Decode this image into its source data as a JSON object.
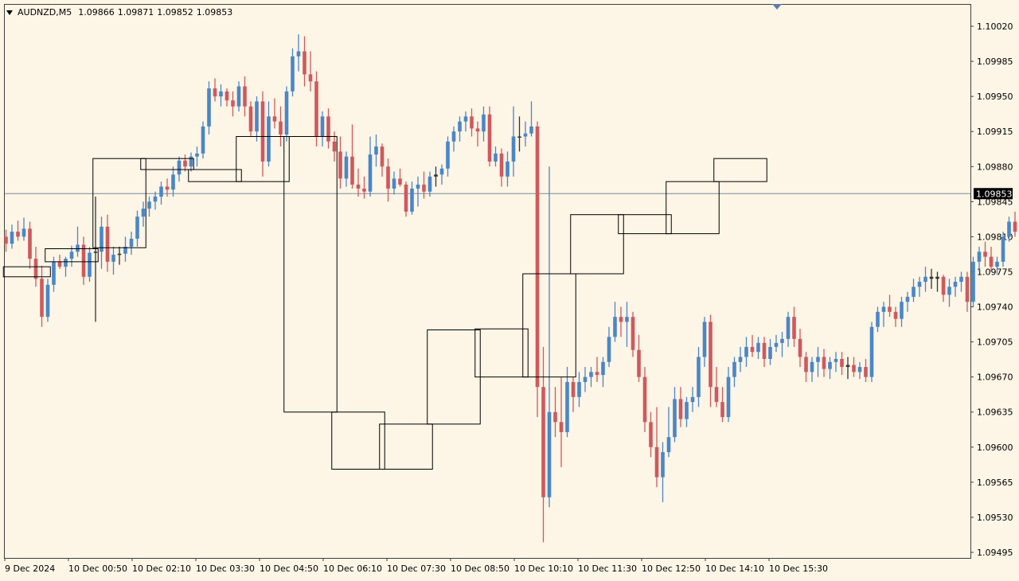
{
  "header": {
    "symbol": "AUDNZD,M5",
    "open": "1.09866",
    "high": "1.09871",
    "low": "1.09852",
    "close": "1.09853"
  },
  "colors": {
    "background": "#fdf5e6",
    "bull": "#4a86c8",
    "bear": "#d0585c",
    "doji": "#333333",
    "highlight": "#5ad45a",
    "box": "#000000",
    "price_line": "#7b8c9c",
    "price_tag_bg": "#000000"
  },
  "chart_data": {
    "type": "candlestick",
    "timeframe": "M5",
    "ylim": [
      1.09495,
      1.1004
    ],
    "y_ticks": [
      "1.10020",
      "1.09985",
      "1.09950",
      "1.09915",
      "1.09880",
      "1.09845",
      "1.09810",
      "1.09775",
      "1.09740",
      "1.09705",
      "1.09670",
      "1.09635",
      "1.09600",
      "1.09565",
      "1.09530",
      "1.09495"
    ],
    "x_ticks": [
      "9 Dec 2024",
      "10 Dec 00:50",
      "10 Dec 02:10",
      "10 Dec 03:30",
      "10 Dec 04:50",
      "10 Dec 06:10",
      "10 Dec 07:30",
      "10 Dec 08:50",
      "10 Dec 10:10",
      "10 Dec 11:30",
      "10 Dec 12:50",
      "10 Dec 14:10",
      "10 Dec 15:30"
    ],
    "current_price": "1.09853",
    "candles": [
      [
        1.0981,
        1.09817,
        1.09795,
        1.09803
      ],
      [
        1.09803,
        1.09822,
        1.09798,
        1.09815
      ],
      [
        1.09815,
        1.09826,
        1.09806,
        1.0981
      ],
      [
        1.0981,
        1.09829,
        1.09806,
        1.09818
      ],
      [
        1.09818,
        1.09825,
        1.09778,
        1.09788
      ],
      [
        1.09788,
        1.098,
        1.0976,
        1.09768
      ],
      [
        1.09768,
        1.09781,
        1.0972,
        1.0973
      ],
      [
        1.0973,
        1.09768,
        1.09725,
        1.09762
      ],
      [
        1.09762,
        1.0979,
        1.09755,
        1.09785
      ],
      [
        1.09785,
        1.09792,
        1.09778,
        1.0978
      ],
      [
        1.0978,
        1.0979,
        1.0977,
        1.09788
      ],
      [
        1.09788,
        1.09801,
        1.0978,
        1.09795
      ],
      [
        1.09795,
        1.0982,
        1.0979,
        1.09802
      ],
      [
        1.09802,
        1.0981,
        1.09762,
        1.0977
      ],
      [
        1.0977,
        1.098,
        1.09765,
        1.09794
      ],
      [
        1.09794,
        1.0985,
        1.09725,
        1.09795
      ],
      [
        1.09795,
        1.0983,
        1.09778,
        1.0982
      ],
      [
        1.0982,
        1.09832,
        1.09775,
        1.09785
      ],
      [
        1.09785,
        1.098,
        1.09772,
        1.09792
      ],
      [
        1.09792,
        1.098,
        1.09782,
        1.09793
      ],
      [
        1.09793,
        1.0981,
        1.09785,
        1.098
      ],
      [
        1.098,
        1.09815,
        1.09792,
        1.09808
      ],
      [
        1.09808,
        1.09836,
        1.098,
        1.0983
      ],
      [
        1.0983,
        1.09845,
        1.0982,
        1.09838
      ],
      [
        1.09838,
        1.0985,
        1.0983,
        1.09845
      ],
      [
        1.09845,
        1.09855,
        1.09837,
        1.0985
      ],
      [
        1.0985,
        1.09865,
        1.09842,
        1.0986
      ],
      [
        1.0986,
        1.09868,
        1.0985,
        1.09857
      ],
      [
        1.09857,
        1.0988,
        1.0985,
        1.09872
      ],
      [
        1.09872,
        1.0989,
        1.09865,
        1.09886
      ],
      [
        1.09886,
        1.09892,
        1.09875,
        1.0988
      ],
      [
        1.0988,
        1.09894,
        1.09875,
        1.0989
      ],
      [
        1.0989,
        1.099,
        1.0988,
        1.09893
      ],
      [
        1.09893,
        1.09925,
        1.09888,
        1.0992
      ],
      [
        1.0992,
        1.09965,
        1.09912,
        1.09958
      ],
      [
        1.09958,
        1.09968,
        1.09945,
        1.0995
      ],
      [
        1.0995,
        1.09962,
        1.0994,
        1.09955
      ],
      [
        1.09955,
        1.09958,
        1.0994,
        1.09946
      ],
      [
        1.09946,
        1.09955,
        1.0993,
        1.0994
      ],
      [
        1.0994,
        1.09965,
        1.09935,
        1.0996
      ],
      [
        1.0996,
        1.0997,
        1.0993,
        1.0994
      ],
      [
        1.0994,
        1.09945,
        1.0991,
        1.09915
      ],
      [
        1.09915,
        1.0995,
        1.09905,
        1.09945
      ],
      [
        1.09945,
        1.09955,
        1.0987,
        1.09885
      ],
      [
        1.09885,
        1.09945,
        1.0988,
        1.0993
      ],
      [
        1.0993,
        1.09948,
        1.09918,
        1.09925
      ],
      [
        1.09925,
        1.0994,
        1.099,
        1.09912
      ],
      [
        1.09912,
        1.0996,
        1.09905,
        1.09955
      ],
      [
        1.09955,
        1.09998,
        1.0995,
        1.0999
      ],
      [
        1.0999,
        1.10012,
        1.09975,
        1.09995
      ],
      [
        1.09995,
        1.1001,
        1.0996,
        1.09972
      ],
      [
        1.09972,
        1.09995,
        1.09955,
        1.09965
      ],
      [
        1.09965,
        1.09975,
        1.099,
        1.0991
      ],
      [
        1.0991,
        1.09935,
        1.099,
        1.0993
      ],
      [
        1.0993,
        1.09938,
        1.09898,
        1.09905
      ],
      [
        1.09905,
        1.09915,
        1.09885,
        1.09895
      ],
      [
        1.09895,
        1.0991,
        1.09858,
        1.09868
      ],
      [
        1.09868,
        1.09895,
        1.0986,
        1.0989
      ],
      [
        1.0989,
        1.09922,
        1.09858,
        1.09862
      ],
      [
        1.09862,
        1.09878,
        1.0985,
        1.09858
      ],
      [
        1.09858,
        1.0987,
        1.09848,
        1.09855
      ],
      [
        1.09855,
        1.0991,
        1.0985,
        1.09892
      ],
      [
        1.09892,
        1.09912,
        1.0988,
        1.099
      ],
      [
        1.099,
        1.09903,
        1.0987,
        1.0988
      ],
      [
        1.0988,
        1.09888,
        1.09845,
        1.09858
      ],
      [
        1.09858,
        1.09875,
        1.09852,
        1.09868
      ],
      [
        1.09868,
        1.09878,
        1.0986,
        1.09862
      ],
      [
        1.09862,
        1.09865,
        1.0983,
        1.09835
      ],
      [
        1.09835,
        1.09865,
        1.09832,
        1.09858
      ],
      [
        1.09858,
        1.0987,
        1.0984,
        1.09862
      ],
      [
        1.09862,
        1.09875,
        1.09848,
        1.09855
      ],
      [
        1.09855,
        1.09875,
        1.0985,
        1.0987
      ],
      [
        1.0987,
        1.0988,
        1.0986,
        1.09872
      ],
      [
        1.09872,
        1.09882,
        1.09862,
        1.09878
      ],
      [
        1.09878,
        1.0991,
        1.0987,
        1.09905
      ],
      [
        1.09905,
        1.0992,
        1.09895,
        1.09915
      ],
      [
        1.09915,
        1.0993,
        1.09905,
        1.09925
      ],
      [
        1.09925,
        1.09935,
        1.09915,
        1.0993
      ],
      [
        1.0993,
        1.09938,
        1.0991,
        1.09918
      ],
      [
        1.09918,
        1.09925,
        1.099,
        1.09915
      ],
      [
        1.09915,
        1.0994,
        1.09905,
        1.09932
      ],
      [
        1.09932,
        1.0994,
        1.0988,
        1.09885
      ],
      [
        1.09885,
        1.099,
        1.0988,
        1.09893
      ],
      [
        1.09893,
        1.09898,
        1.0986,
        1.0987
      ],
      [
        1.0987,
        1.09895,
        1.0986,
        1.09885
      ],
      [
        1.09885,
        1.0994,
        1.0987,
        1.0991
      ],
      [
        1.0991,
        1.0993,
        1.09895,
        1.0991
      ],
      [
        1.0991,
        1.09925,
        1.099,
        1.09913
      ],
      [
        1.09913,
        1.09945,
        1.0991,
        1.0992
      ],
      [
        1.0992,
        1.09925,
        1.0963,
        1.0966
      ],
      [
        1.0966,
        1.097,
        1.09505,
        1.0955
      ],
      [
        1.0955,
        1.0988,
        1.0954,
        1.09635
      ],
      [
        1.09635,
        1.0966,
        1.0961,
        1.09625
      ],
      [
        1.09625,
        1.0967,
        1.0958,
        1.09615
      ],
      [
        1.09615,
        1.0968,
        1.0961,
        1.09665
      ],
      [
        1.09665,
        1.0967,
        1.09635,
        1.0965
      ],
      [
        1.0965,
        1.09675,
        1.0964,
        1.09665
      ],
      [
        1.09665,
        1.0968,
        1.09655,
        1.0967
      ],
      [
        1.0967,
        1.0968,
        1.0966,
        1.09675
      ],
      [
        1.09675,
        1.0969,
        1.09665,
        1.09672
      ],
      [
        1.09672,
        1.0969,
        1.0966,
        1.09685
      ],
      [
        1.09685,
        1.0972,
        1.0968,
        1.0971
      ],
      [
        1.0971,
        1.09745,
        1.09705,
        1.0973
      ],
      [
        1.0973,
        1.0974,
        1.0971,
        1.09725
      ],
      [
        1.09725,
        1.09745,
        1.097,
        1.0973
      ],
      [
        1.0973,
        1.09735,
        1.0969,
        1.09697
      ],
      [
        1.09697,
        1.09712,
        1.09665,
        1.0967
      ],
      [
        1.0967,
        1.0968,
        1.09615,
        1.09625
      ],
      [
        1.09625,
        1.09635,
        1.0959,
        1.096
      ],
      [
        1.096,
        1.0964,
        1.0956,
        1.0957
      ],
      [
        1.0957,
        1.09605,
        1.09545,
        1.09595
      ],
      [
        1.09595,
        1.0964,
        1.0959,
        1.0961
      ],
      [
        1.0961,
        1.0966,
        1.09605,
        1.09648
      ],
      [
        1.09648,
        1.0966,
        1.0962,
        1.09628
      ],
      [
        1.09628,
        1.0965,
        1.0962,
        1.09645
      ],
      [
        1.09645,
        1.0966,
        1.09635,
        1.0965
      ],
      [
        1.0965,
        1.097,
        1.0964,
        1.0969
      ],
      [
        1.0969,
        1.0973,
        1.0968,
        1.09725
      ],
      [
        1.09725,
        1.09732,
        1.0964,
        1.0966
      ],
      [
        1.0966,
        1.0968,
        1.0964,
        1.09645
      ],
      [
        1.09645,
        1.0966,
        1.09625,
        1.0963
      ],
      [
        1.0963,
        1.0968,
        1.09625,
        1.0967
      ],
      [
        1.0967,
        1.0969,
        1.0966,
        1.09685
      ],
      [
        1.09685,
        1.097,
        1.09675,
        1.0969
      ],
      [
        1.0969,
        1.0971,
        1.0968,
        1.097
      ],
      [
        1.097,
        1.09712,
        1.0969,
        1.09695
      ],
      [
        1.09695,
        1.0971,
        1.09688,
        1.09704
      ],
      [
        1.09704,
        1.0971,
        1.0968,
        1.09688
      ],
      [
        1.09688,
        1.09708,
        1.09682,
        1.097
      ],
      [
        1.097,
        1.09712,
        1.09695,
        1.09704
      ],
      [
        1.09704,
        1.09715,
        1.0969,
        1.09708
      ],
      [
        1.09708,
        1.09735,
        1.097,
        1.0973
      ],
      [
        1.0973,
        1.0974,
        1.097,
        1.09708
      ],
      [
        1.09708,
        1.09718,
        1.0968,
        1.0969
      ],
      [
        1.0969,
        1.09695,
        1.09665,
        1.09675
      ],
      [
        1.09675,
        1.0969,
        1.09665,
        1.09685
      ],
      [
        1.09685,
        1.097,
        1.0967,
        1.0969
      ],
      [
        1.0969,
        1.09698,
        1.0967,
        1.09678
      ],
      [
        1.09678,
        1.0969,
        1.09668,
        1.09685
      ],
      [
        1.09685,
        1.09695,
        1.09675,
        1.09688
      ],
      [
        1.09688,
        1.09695,
        1.09672,
        1.0968
      ],
      [
        1.0968,
        1.0969,
        1.09668,
        1.09682
      ],
      [
        1.09682,
        1.0969,
        1.0967,
        1.09675
      ],
      [
        1.09675,
        1.09685,
        1.09668,
        1.0968
      ],
      [
        1.0968,
        1.09688,
        1.09665,
        1.0967
      ],
      [
        1.0967,
        1.09725,
        1.09665,
        1.0972
      ],
      [
        1.0972,
        1.0974,
        1.09715,
        1.09735
      ],
      [
        1.09735,
        1.09745,
        1.0972,
        1.0974
      ],
      [
        1.0974,
        1.09752,
        1.0973,
        1.09735
      ],
      [
        1.09735,
        1.0974,
        1.0972,
        1.09728
      ],
      [
        1.09728,
        1.0975,
        1.0972,
        1.09745
      ],
      [
        1.09745,
        1.09755,
        1.09735,
        1.0975
      ],
      [
        1.0975,
        1.09768,
        1.09745,
        1.0976
      ],
      [
        1.0976,
        1.0977,
        1.0975,
        1.09765
      ],
      [
        1.09765,
        1.0978,
        1.09755,
        1.0977
      ],
      [
        1.0977,
        1.09778,
        1.09758,
        1.09768
      ],
      [
        1.09768,
        1.09775,
        1.09755,
        1.0977
      ],
      [
        1.0977,
        1.09772,
        1.09745,
        1.09752
      ],
      [
        1.09752,
        1.09768,
        1.0974,
        1.0976
      ],
      [
        1.0976,
        1.0977,
        1.0975,
        1.09765
      ],
      [
        1.09765,
        1.09775,
        1.09755,
        1.0977
      ],
      [
        1.0977,
        1.09775,
        1.09735,
        1.09745
      ],
      [
        1.09745,
        1.0979,
        1.0974,
        1.09785
      ],
      [
        1.09785,
        1.098,
        1.09775,
        1.09795
      ],
      [
        1.09795,
        1.09805,
        1.0978,
        1.0979
      ],
      [
        1.0979,
        1.098,
        1.09775,
        1.0978
      ],
      [
        1.0978,
        1.0979,
        1.09772,
        1.09785
      ],
      [
        1.09785,
        1.09815,
        1.0978,
        1.0981
      ],
      [
        1.0981,
        1.0983,
        1.09805,
        1.09825
      ],
      [
        1.09825,
        1.09835,
        1.0981,
        1.09815
      ],
      [
        1.09815,
        1.09845,
        1.0981,
        1.0984
      ],
      [
        1.0984,
        1.09845,
        1.0981,
        1.09818
      ],
      [
        1.09818,
        1.0983,
        1.0981,
        1.09825
      ],
      [
        1.09825,
        1.0983,
        1.09805,
        1.09812
      ],
      [
        1.09812,
        1.0983,
        1.09808,
        1.09825
      ],
      [
        1.09825,
        1.09835,
        1.09815,
        1.0983
      ],
      [
        1.0983,
        1.0984,
        1.0982,
        1.09828
      ],
      [
        1.09828,
        1.09835,
        1.0981,
        1.09815
      ],
      [
        1.09815,
        1.0983,
        1.098,
        1.09822
      ],
      [
        1.09822,
        1.0983,
        1.0981,
        1.09818
      ],
      [
        1.09818,
        1.09825,
        1.09805,
        1.0981
      ],
      [
        1.0981,
        1.09822,
        1.098,
        1.09815
      ],
      [
        1.09815,
        1.0983,
        1.0981,
        1.0982
      ],
      [
        1.0982,
        1.0984,
        1.09815,
        1.09835
      ],
      [
        1.09835,
        1.0985,
        1.0983,
        1.09845
      ],
      [
        1.09845,
        1.09855,
        1.09835,
        1.09848
      ],
      [
        1.09848,
        1.09875,
        1.0984,
        1.09868
      ],
      [
        1.09868,
        1.09885,
        1.0986,
        1.09875
      ],
      [
        1.09875,
        1.0988,
        1.0986,
        1.0987
      ],
      [
        1.0987,
        1.09882,
        1.09865,
        1.09875
      ],
      [
        1.09875,
        1.09885,
        1.0986,
        1.0987
      ],
      [
        1.0987,
        1.09892,
        1.09865,
        1.09888
      ],
      [
        1.09888,
        1.09895,
        1.0987,
        1.09875
      ],
      [
        1.09875,
        1.0988,
        1.0986,
        1.09865
      ],
      [
        1.09865,
        1.09875,
        1.09855,
        1.0987
      ],
      [
        1.0987,
        1.09878,
        1.0985,
        1.09855
      ],
      [
        1.09855,
        1.0987,
        1.09848,
        1.09865
      ],
      [
        1.09865,
        1.0988,
        1.09858,
        1.09875
      ],
      [
        1.09875,
        1.0989,
        1.0987,
        1.09885
      ],
      [
        1.09885,
        1.09895,
        1.09875,
        1.0989
      ],
      [
        1.0989,
        1.09905,
        1.0988,
        1.09898
      ],
      [
        1.09898,
        1.09925,
        1.0989,
        1.09918
      ],
      [
        1.09918,
        1.0993,
        1.0991,
        1.09925
      ],
      [
        1.09925,
        1.09938,
        1.0991,
        1.09915
      ],
      [
        1.09915,
        1.09925,
        1.09885,
        1.09892
      ],
      [
        1.09892,
        1.09898,
        1.0987,
        1.09875
      ],
      [
        1.09875,
        1.0988,
        1.0985,
        1.09853
      ]
    ],
    "boxes": [
      {
        "i0": 0,
        "i1": 7,
        "low": 1.0977,
        "high": 1.0978
      },
      {
        "i0": 7,
        "i1": 15,
        "low": 1.09785,
        "high": 1.09798
      },
      {
        "i0": 15,
        "i1": 23,
        "low": 1.09799,
        "high": 1.09888
      },
      {
        "i0": 23,
        "i1": 31,
        "low": 1.09877,
        "high": 1.09888
      },
      {
        "i0": 31,
        "i1": 39,
        "low": 1.09865,
        "high": 1.09877
      },
      {
        "i0": 39,
        "i1": 47,
        "low": 1.09865,
        "high": 1.0991
      },
      {
        "i0": 47,
        "i1": 55,
        "low": 1.09635,
        "high": 1.0991
      },
      {
        "i0": 55,
        "i1": 63,
        "low": 1.09578,
        "high": 1.09635
      },
      {
        "i0": 63,
        "i1": 71,
        "low": 1.09578,
        "high": 1.09623
      },
      {
        "i0": 71,
        "i1": 79,
        "low": 1.09623,
        "high": 1.09717
      },
      {
        "i0": 79,
        "i1": 87,
        "low": 1.0967,
        "high": 1.09718
      },
      {
        "i0": 87,
        "i1": 95,
        "low": 1.0967,
        "high": 1.09773
      },
      {
        "i0": 95,
        "i1": 103,
        "low": 1.09773,
        "high": 1.09832
      },
      {
        "i0": 103,
        "i1": 111,
        "low": 1.09813,
        "high": 1.09832
      },
      {
        "i0": 111,
        "i1": 119,
        "low": 1.09813,
        "high": 1.09865
      },
      {
        "i0": 119,
        "i1": 127,
        "low": 1.09865,
        "high": 1.09888
      }
    ]
  }
}
